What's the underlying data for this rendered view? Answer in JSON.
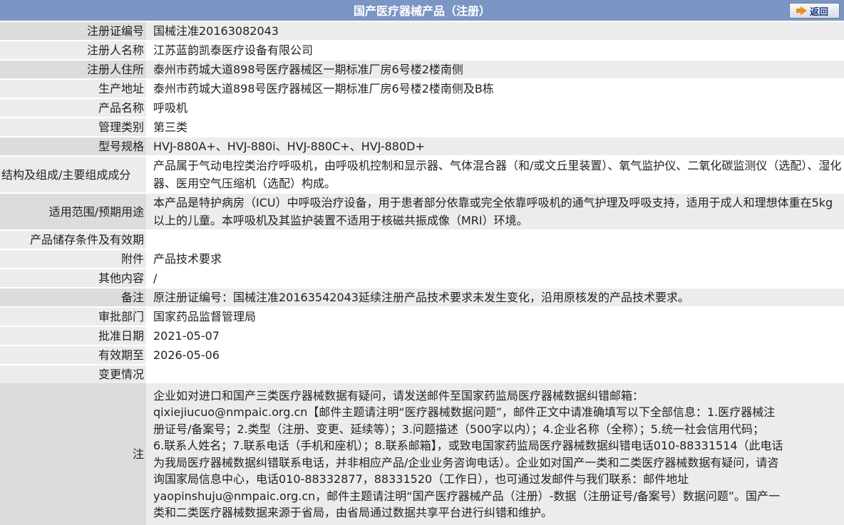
{
  "header": {
    "title": "国产医疗器械产品（注册）",
    "back_label": "返回"
  },
  "rows": [
    {
      "label": "注册证编号",
      "value": "国械注准20163082043"
    },
    {
      "label": "注册人名称",
      "value": "江苏蓝韵凯泰医疗设备有限公司"
    },
    {
      "label": "注册人住所",
      "value": "泰州市药城大道898号医疗器械区一期标准厂房6号楼2楼南侧"
    },
    {
      "label": "生产地址",
      "value": "泰州市药城大道898号医疗器械区一期标准厂房6号楼2楼南侧及B栋"
    },
    {
      "label": "产品名称",
      "value": "呼吸机"
    },
    {
      "label": "管理类别",
      "value": "第三类"
    },
    {
      "label": "型号规格",
      "value": "HVJ-880A+、HVJ-880i、HVJ-880C+、HVJ-880D+"
    },
    {
      "label": "结构及组成/主要组成成分",
      "value": "产品属于气动电控类治疗呼吸机，由呼吸机控制和显示器、气体混合器（和/或文丘里装置）、氧气监护仪、二氧化碳监测仪（选配）、湿化器、医用空气压缩机（选配）构成。"
    },
    {
      "label": "适用范围/预期用途",
      "value": "本产品是特护病房（ICU）中呼吸治疗设备，用于患者部分依靠或完全依靠呼吸机的通气护理及呼吸支持，适用于成人和理想体重在5kg以上的儿童。本呼吸机及其监护装置不适用于核磁共振成像（MRI）环境。"
    },
    {
      "label": "产品储存条件及有效期",
      "value": ""
    },
    {
      "label": "附件",
      "value": "产品技术要求"
    },
    {
      "label": "其他内容",
      "value": "/"
    },
    {
      "label": "备注",
      "value": "原注册证编号：国械注准20163542043延续注册产品技术要求未发生变化，沿用原核发的产品技术要求。"
    },
    {
      "label": "审批部门",
      "value": "国家药品监督管理局"
    },
    {
      "label": "批准日期",
      "value": "2021-05-07"
    },
    {
      "label": "有效期至",
      "value": "2026-05-06"
    },
    {
      "label": "变更情况",
      "value": ""
    }
  ],
  "note": {
    "label": "注",
    "lines": [
      "企业如对进口和国产三类医疗器械数据有疑问，请发送邮件至国家药监局医疗器械数据纠错邮箱：",
      "qixiejiucuo@nmpaic.org.cn【邮件主题请注明“医疗器械数据问题”，邮件正文中请准确填写以下全部信息：1.医疗器械注",
      "册证号/备案号；2.类型（注册、变更、延续等）；3.问题描述（500字以内）；4.企业名称（全称）；5.统一社会信用代码；",
      "6.联系人姓名；7.联系电话（手机和座机）；8.联系邮箱】，或致电国家药监局医疗器械数据纠错电话010-88331514（此电话",
      "为我局医疗器械数据纠错联系电话，并非相应产品/企业业务咨询电话）。企业如对国产一类和二类医疗器械数据有疑问，请咨",
      "询国家局信息中心，电话010-88332877，88331520（工作日），也可通过发邮件与我们联系：邮件地址",
      "yaopinshuju@nmpaic.org.cn，邮件主题请注明“国产医疗器械产品（注册）-数据（注册证号/备案号）数据问题”。国产一",
      "类和二类医疗器械数据来源于省局，由省局通过数据共享平台进行纠错和维护。"
    ]
  }
}
